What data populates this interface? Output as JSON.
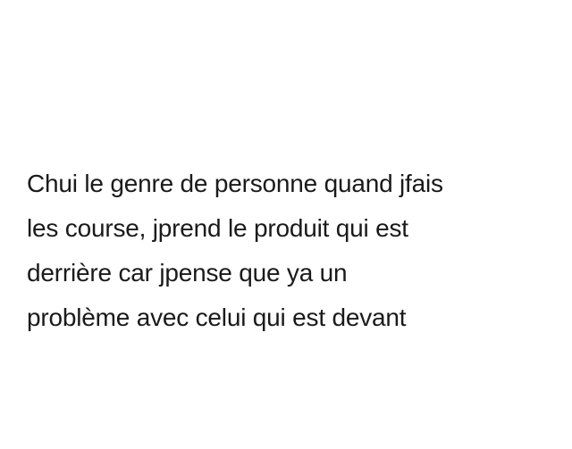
{
  "post": {
    "lines": [
      "Chui le genre de personne quand jfais",
      "les course, jprend le produit qui est",
      "derrière car jpense que ya un",
      "problème avec celui qui est devant"
    ]
  }
}
